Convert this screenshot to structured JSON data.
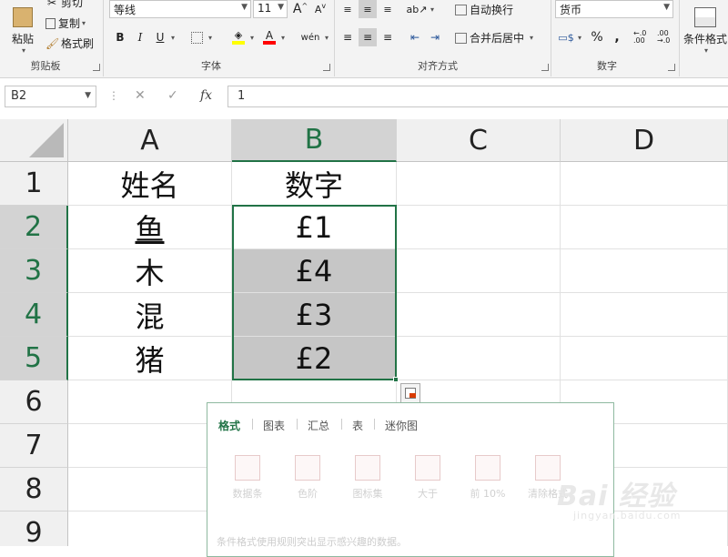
{
  "ribbon": {
    "clipboard": {
      "paste": "粘贴",
      "cut": "剪切",
      "copy": "复制",
      "format_painter": "格式刷",
      "label": "剪贴板"
    },
    "font": {
      "name": "等线",
      "size": "11",
      "bold": "B",
      "italic": "I",
      "underline": "U",
      "grow": "A",
      "shrink": "A",
      "font_color_glyph": "A",
      "phonetic": "wén",
      "label": "字体"
    },
    "alignment": {
      "wrap": "自动换行",
      "merge": "合并后居中",
      "label": "对齐方式"
    },
    "number": {
      "format": "货币",
      "percent": "%",
      "comma": ",",
      "inc_decimal": "←.0 .00",
      "dec_decimal": ".00 →.0",
      "label": "数字"
    },
    "styles": {
      "conditional": "条件格式"
    }
  },
  "formula_bar": {
    "name_box": "B2",
    "cancel": "✕",
    "enter": "✓",
    "fx": "fx",
    "value": "1"
  },
  "sheet": {
    "columns": [
      "A",
      "B",
      "C",
      "D"
    ],
    "rows": [
      "1",
      "2",
      "3",
      "4",
      "5",
      "6",
      "7",
      "8",
      "9"
    ],
    "cells": {
      "A1": "姓名",
      "B1": "数字",
      "A2": "鱼",
      "B2": "£1",
      "A3": "木",
      "B3": "£4",
      "A4": "混",
      "B4": "£3",
      "A5": "猪",
      "B5": "£2"
    },
    "selection": "B2:B5"
  },
  "quick_analysis": {
    "tabs": [
      "格式",
      "图表",
      "汇总",
      "表",
      "迷你图"
    ],
    "active_tab": "格式",
    "options": [
      "数据条",
      "色阶",
      "图标集",
      "大于",
      "前 10%",
      "清除格式"
    ],
    "description": "条件格式使用规则突出显示感兴趣的数据。"
  },
  "watermark": {
    "brand": "Bai 经验",
    "url": "jingyan.baidu.com"
  },
  "colors": {
    "accent": "#217346",
    "selection_fill": "#c6c6c6",
    "header_bg": "#f0f0f0"
  }
}
